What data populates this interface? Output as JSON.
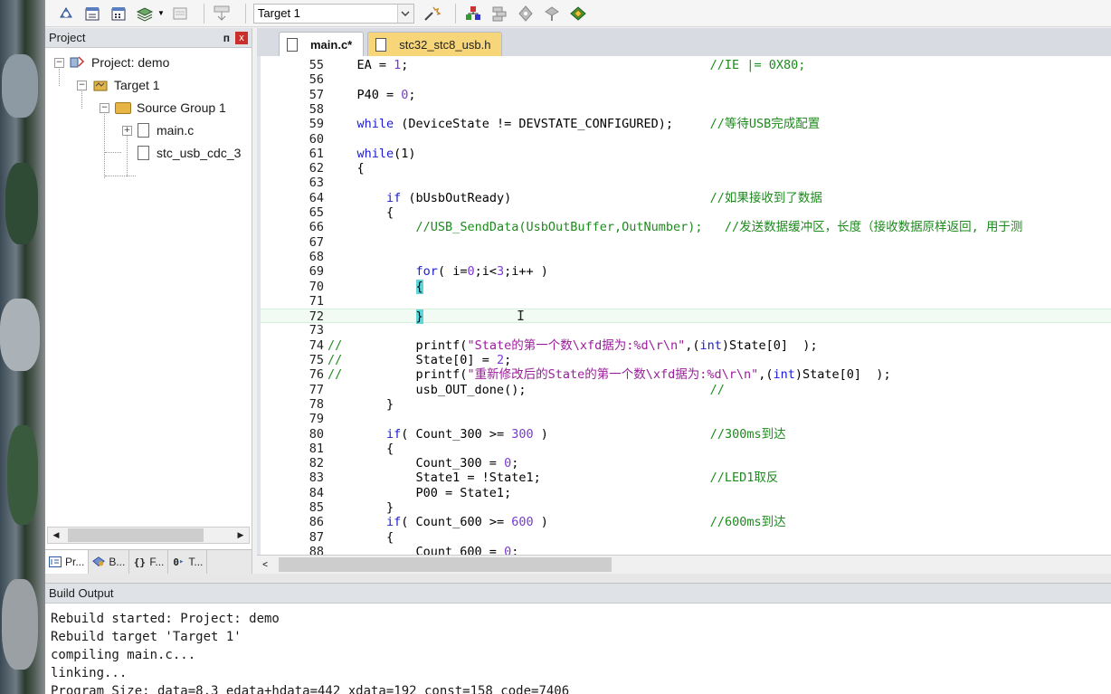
{
  "toolbar": {
    "target_value": "Target 1"
  },
  "project_panel": {
    "title": "Project",
    "pin_glyph": "ᴨ",
    "close_glyph": "x",
    "tree": {
      "project": "Project: demo",
      "target": "Target 1",
      "group": "Source Group 1",
      "file1": "main.c",
      "file2": "stc_usb_cdc_3"
    },
    "bottom_tabs": [
      "Pr...",
      "B...",
      "F...",
      "T..."
    ]
  },
  "editor": {
    "tabs": [
      {
        "label": "main.c*",
        "active": true
      },
      {
        "label": "stc32_stc8_usb.h",
        "active": false
      }
    ],
    "lines": [
      {
        "n": "55",
        "code": "    EA = 1;                                         //IE |= 0X80;"
      },
      {
        "n": "56",
        "code": ""
      },
      {
        "n": "57",
        "code": "    P40 = 0;"
      },
      {
        "n": "58",
        "code": ""
      },
      {
        "n": "59",
        "code": "    while (DeviceState != DEVSTATE_CONFIGURED);     //等待USB完成配置"
      },
      {
        "n": "60",
        "code": ""
      },
      {
        "n": "61",
        "code": "    while(1)"
      },
      {
        "n": "62",
        "code": "    {"
      },
      {
        "n": "63",
        "code": ""
      },
      {
        "n": "64",
        "code": "        if (bUsbOutReady)                           //如果接收到了数据"
      },
      {
        "n": "65",
        "code": "        {"
      },
      {
        "n": "66",
        "code": "            //USB_SendData(UsbOutBuffer,OutNumber);   //发送数据缓冲区，长度（接收数据原样返回, 用于测"
      },
      {
        "n": "67",
        "code": ""
      },
      {
        "n": "68",
        "code": ""
      },
      {
        "n": "69",
        "code": "            for( i=0;i<3;i++ )"
      },
      {
        "n": "70",
        "code": "            {"
      },
      {
        "n": "71",
        "code": ""
      },
      {
        "n": "72",
        "code": "            }"
      },
      {
        "n": "73",
        "code": ""
      },
      {
        "n": "74",
        "code": "//          printf(\"State的第一个数\\xfd据为:%d\\r\\n\",(int)State[0]  );"
      },
      {
        "n": "75",
        "code": "//          State[0] = 2;"
      },
      {
        "n": "76",
        "code": "//          printf(\"重新修改后的State的第一个数\\xfd据为:%d\\r\\n\",(int)State[0]  );"
      },
      {
        "n": "77",
        "code": "            usb_OUT_done();                         //"
      },
      {
        "n": "78",
        "code": "        }"
      },
      {
        "n": "79",
        "code": ""
      },
      {
        "n": "80",
        "code": "        if( Count_300 >= 300 )                      //300ms到达"
      },
      {
        "n": "81",
        "code": "        {"
      },
      {
        "n": "82",
        "code": "            Count_300 = 0;"
      },
      {
        "n": "83",
        "code": "            State1 = !State1;                       //LED1取反"
      },
      {
        "n": "84",
        "code": "            P00 = State1;"
      },
      {
        "n": "85",
        "code": "        }"
      },
      {
        "n": "86",
        "code": "        if( Count_600 >= 600 )                      //600ms到达"
      },
      {
        "n": "87",
        "code": "        {"
      },
      {
        "n": "88",
        "code": "            Count_600 = 0;"
      }
    ]
  },
  "build_output": {
    "title": "Build Output",
    "lines": [
      "Rebuild started: Project: demo",
      "Rebuild target 'Target 1'",
      "compiling main.c...",
      "linking...",
      "Program Size: data=8.3 edata+hdata=442 xdata=192 const=158 code=7406"
    ]
  }
}
